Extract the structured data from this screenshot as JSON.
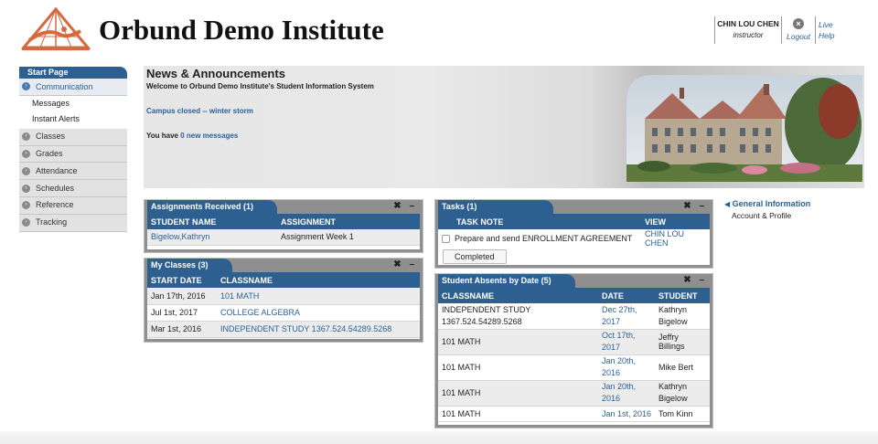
{
  "header": {
    "title": "Orbund Demo Institute",
    "user_name": "CHIN LOU CHEN",
    "user_role": "instructor",
    "logout_label": "Logout",
    "live_label": "Live",
    "help_label": "Help"
  },
  "sidebar": {
    "heading": "Start Page",
    "items": [
      {
        "label": "Communication"
      },
      {
        "label": "Messages"
      },
      {
        "label": "Instant Alerts"
      },
      {
        "label": "Classes"
      },
      {
        "label": "Grades"
      },
      {
        "label": "Attendance"
      },
      {
        "label": "Schedules"
      },
      {
        "label": "Reference"
      },
      {
        "label": "Tracking"
      }
    ]
  },
  "news": {
    "title": "News & Announcements",
    "welcome": "Welcome to Orbund Demo Institute's Student Information System",
    "announcement": "Campus closed -- winter storm",
    "messages_prefix": "You have",
    "messages_link": "0 new messages"
  },
  "assignments": {
    "title": "Assignments Received (1)",
    "columns": [
      "STUDENT NAME",
      "ASSIGNMENT"
    ],
    "rows": [
      [
        "Bigelow,Kathryn",
        "Assignment Week 1"
      ]
    ]
  },
  "classes": {
    "title": "My Classes (3)",
    "columns": [
      "START DATE",
      "CLASSNAME"
    ],
    "rows": [
      [
        "Jan 17th, 2016",
        "101 MATH"
      ],
      [
        "Jul 1st, 2017",
        "COLLEGE ALGEBRA"
      ],
      [
        "Mar 1st, 2016",
        "INDEPENDENT STUDY 1367.524.54289.5268"
      ]
    ]
  },
  "tasks": {
    "title": "Tasks (1)",
    "columns": [
      "TASK NOTE",
      "VIEW"
    ],
    "rows": [
      [
        "Prepare and send ENROLLMENT AGREEMENT",
        "CHIN LOU CHEN"
      ]
    ],
    "completed_label": "Completed"
  },
  "absents": {
    "title": "Student Absents by Date (5)",
    "columns": [
      "CLASSNAME",
      "DATE",
      "STUDENT"
    ],
    "rows": [
      [
        "INDEPENDENT STUDY 1367.524.54289.5268",
        "Dec 27th, 2017",
        "Kathryn Bigelow"
      ],
      [
        "101 MATH",
        "Oct 17th, 2017",
        "Jeffry Billings"
      ],
      [
        "101 MATH",
        "Jan 20th, 2016",
        "Mike Bert"
      ],
      [
        "101 MATH",
        "Jan 20th, 2016",
        "Kathryn Bigelow"
      ],
      [
        "101 MATH",
        "Jan 1st, 2016",
        "Tom Kinn"
      ]
    ]
  },
  "right_links": {
    "general_info": "General Information",
    "account_profile": "Account & Profile"
  },
  "panel_controls": "✖ –"
}
